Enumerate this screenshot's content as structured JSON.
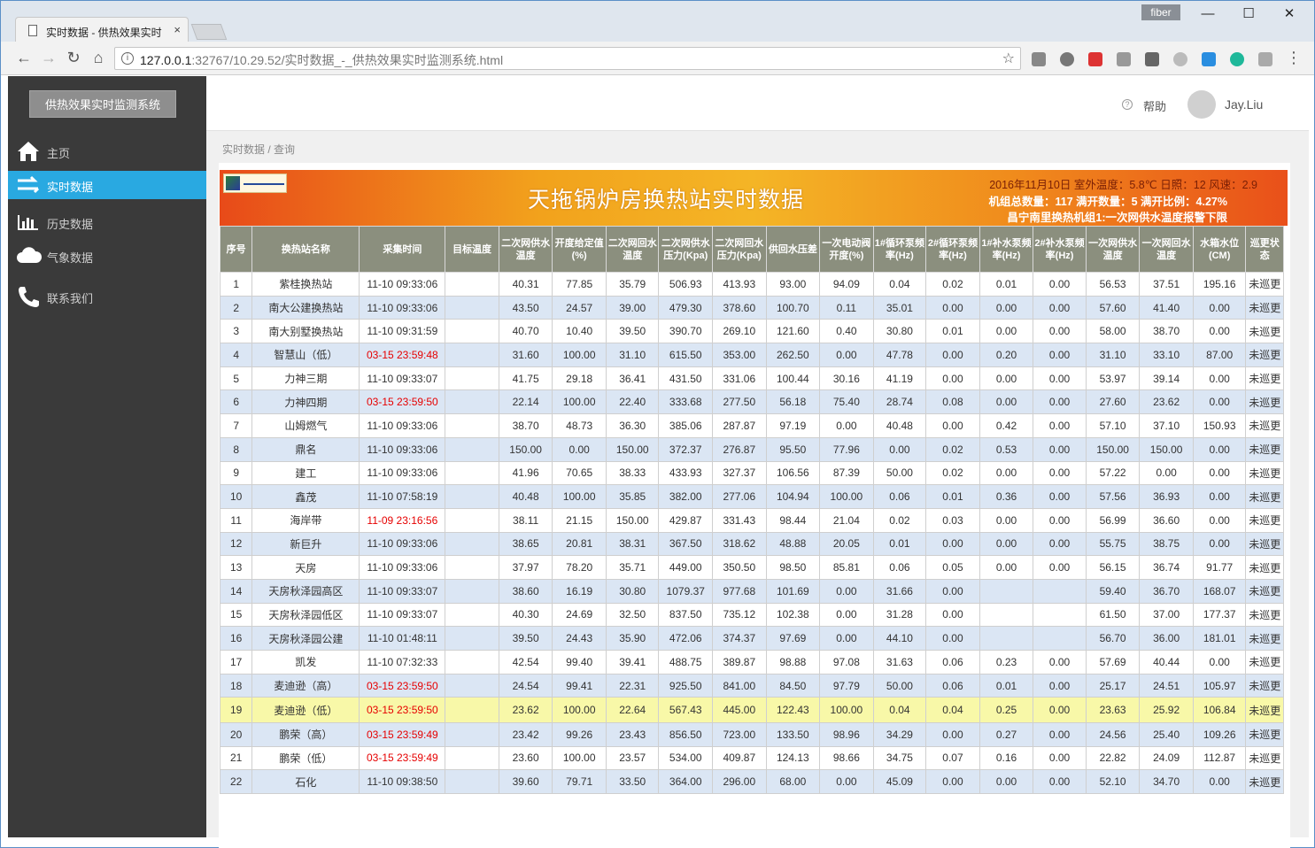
{
  "browser": {
    "tab_title": "实时数据 - 供热效果实时",
    "tab_close": "×",
    "profile": "fiber",
    "url_host": "127.0.0.1",
    "url_rest": ":32767/10.29.52/实时数据_-_供热效果实时监测系统.html",
    "minimize": "—",
    "maximize": "☐",
    "close": "✕",
    "back": "←",
    "forward": "→",
    "reload": "↻",
    "home": "⌂",
    "star": "☆",
    "menu": "⋮"
  },
  "sidebar": {
    "brand": "供热效果实时监测系统",
    "items": [
      {
        "label": "主页",
        "icon": "home-icon"
      },
      {
        "label": "实时数据",
        "icon": "exchange-icon"
      },
      {
        "label": "历史数据",
        "icon": "bar-chart-icon"
      },
      {
        "label": "气象数据",
        "icon": "cloud-icon"
      },
      {
        "label": "联系我们",
        "icon": "phone-icon"
      }
    ]
  },
  "header": {
    "help_icon": "?",
    "help": "帮助",
    "user": "Jay.Liu"
  },
  "breadcrumb": "实时数据 / 查询",
  "banner": {
    "title": "天拖锅炉房换热站实时数据",
    "line1": "2016年11月10日 室外温度：5.8℃ 日照：12 风速：2.9",
    "line2": "机组总数量：117 满开数量：5 满开比例：4.27%",
    "line3": "昌宁南里换热机组1:一次网供水温度报警下限"
  },
  "table": {
    "headers": [
      "序号",
      "换热站名称",
      "采集时间",
      "目标温度",
      "二次网供水温度",
      "开度给定值(%)",
      "二次网回水温度",
      "二次网供水压力(Kpa)",
      "二次网回水压力(Kpa)",
      "供回水压差",
      "一次电动阀开度(%)",
      "1#循环泵频率(Hz)",
      "2#循环泵频率(Hz)",
      "1#补水泵频率(Hz)",
      "2#补水泵频率(Hz)",
      "一次网供水温度",
      "一次网回水温度",
      "水箱水位(CM)",
      "巡更状态"
    ],
    "rows": [
      [
        "1",
        "紫桂换热站",
        "11-10 09:33:06",
        "",
        "40.31",
        "77.85",
        "35.79",
        "506.93",
        "413.93",
        "93.00",
        "94.09",
        "0.04",
        "0.02",
        "0.01",
        "0.00",
        "56.53",
        "37.51",
        "195.16",
        "未巡更"
      ],
      [
        "2",
        "南大公建换热站",
        "11-10 09:33:06",
        "",
        "43.50",
        "24.57",
        "39.00",
        "479.30",
        "378.60",
        "100.70",
        "0.11",
        "35.01",
        "0.00",
        "0.00",
        "0.00",
        "57.60",
        "41.40",
        "0.00",
        "未巡更"
      ],
      [
        "3",
        "南大别墅换热站",
        "11-10 09:31:59",
        "",
        "40.70",
        "10.40",
        "39.50",
        "390.70",
        "269.10",
        "121.60",
        "0.40",
        "30.80",
        "0.01",
        "0.00",
        "0.00",
        "58.00",
        "38.70",
        "0.00",
        "未巡更"
      ],
      [
        "4",
        "智慧山（低）",
        "03-15 23:59:48",
        "",
        "31.60",
        "100.00",
        "31.10",
        "615.50",
        "353.00",
        "262.50",
        "0.00",
        "47.78",
        "0.00",
        "0.20",
        "0.00",
        "31.10",
        "33.10",
        "87.00",
        "未巡更"
      ],
      [
        "5",
        "力神三期",
        "11-10 09:33:07",
        "",
        "41.75",
        "29.18",
        "36.41",
        "431.50",
        "331.06",
        "100.44",
        "30.16",
        "41.19",
        "0.00",
        "0.00",
        "0.00",
        "53.97",
        "39.14",
        "0.00",
        "未巡更"
      ],
      [
        "6",
        "力神四期",
        "03-15 23:59:50",
        "",
        "22.14",
        "100.00",
        "22.40",
        "333.68",
        "277.50",
        "56.18",
        "75.40",
        "28.74",
        "0.08",
        "0.00",
        "0.00",
        "27.60",
        "23.62",
        "0.00",
        "未巡更"
      ],
      [
        "7",
        "山姆燃气",
        "11-10 09:33:06",
        "",
        "38.70",
        "48.73",
        "36.30",
        "385.06",
        "287.87",
        "97.19",
        "0.00",
        "40.48",
        "0.00",
        "0.42",
        "0.00",
        "57.10",
        "37.10",
        "150.93",
        "未巡更"
      ],
      [
        "8",
        "鼎名",
        "11-10 09:33:06",
        "",
        "150.00",
        "0.00",
        "150.00",
        "372.37",
        "276.87",
        "95.50",
        "77.96",
        "0.00",
        "0.02",
        "0.53",
        "0.00",
        "150.00",
        "150.00",
        "0.00",
        "未巡更"
      ],
      [
        "9",
        "建工",
        "11-10 09:33:06",
        "",
        "41.96",
        "70.65",
        "38.33",
        "433.93",
        "327.37",
        "106.56",
        "87.39",
        "50.00",
        "0.02",
        "0.00",
        "0.00",
        "57.22",
        "0.00",
        "0.00",
        "未巡更"
      ],
      [
        "10",
        "鑫茂",
        "11-10 07:58:19",
        "",
        "40.48",
        "100.00",
        "35.85",
        "382.00",
        "277.06",
        "104.94",
        "100.00",
        "0.06",
        "0.01",
        "0.36",
        "0.00",
        "57.56",
        "36.93",
        "0.00",
        "未巡更"
      ],
      [
        "11",
        "海岸带",
        "11-09 23:16:56",
        "",
        "38.11",
        "21.15",
        "150.00",
        "429.87",
        "331.43",
        "98.44",
        "21.04",
        "0.02",
        "0.03",
        "0.00",
        "0.00",
        "56.99",
        "36.60",
        "0.00",
        "未巡更"
      ],
      [
        "12",
        "新巨升",
        "11-10 09:33:06",
        "",
        "38.65",
        "20.81",
        "38.31",
        "367.50",
        "318.62",
        "48.88",
        "20.05",
        "0.01",
        "0.00",
        "0.00",
        "0.00",
        "55.75",
        "38.75",
        "0.00",
        "未巡更"
      ],
      [
        "13",
        "天房",
        "11-10 09:33:06",
        "",
        "37.97",
        "78.20",
        "35.71",
        "449.00",
        "350.50",
        "98.50",
        "85.81",
        "0.06",
        "0.05",
        "0.00",
        "0.00",
        "56.15",
        "36.74",
        "91.77",
        "未巡更"
      ],
      [
        "14",
        "天房秋泽园高区",
        "11-10 09:33:07",
        "",
        "38.60",
        "16.19",
        "30.80",
        "1079.37",
        "977.68",
        "101.69",
        "0.00",
        "31.66",
        "0.00",
        "",
        "",
        "59.40",
        "36.70",
        "168.07",
        "未巡更"
      ],
      [
        "15",
        "天房秋泽园低区",
        "11-10 09:33:07",
        "",
        "40.30",
        "24.69",
        "32.50",
        "837.50",
        "735.12",
        "102.38",
        "0.00",
        "31.28",
        "0.00",
        "",
        "",
        "61.50",
        "37.00",
        "177.37",
        "未巡更"
      ],
      [
        "16",
        "天房秋泽园公建",
        "11-10 01:48:11",
        "",
        "39.50",
        "24.43",
        "35.90",
        "472.06",
        "374.37",
        "97.69",
        "0.00",
        "44.10",
        "0.00",
        "",
        "",
        "56.70",
        "36.00",
        "181.01",
        "未巡更"
      ],
      [
        "17",
        "凯发",
        "11-10 07:32:33",
        "",
        "42.54",
        "99.40",
        "39.41",
        "488.75",
        "389.87",
        "98.88",
        "97.08",
        "31.63",
        "0.06",
        "0.23",
        "0.00",
        "57.69",
        "40.44",
        "0.00",
        "未巡更"
      ],
      [
        "18",
        "麦迪逊（高）",
        "03-15 23:59:50",
        "",
        "24.54",
        "99.41",
        "22.31",
        "925.50",
        "841.00",
        "84.50",
        "97.79",
        "50.00",
        "0.06",
        "0.01",
        "0.00",
        "25.17",
        "24.51",
        "105.97",
        "未巡更"
      ],
      [
        "19",
        "麦迪逊（低）",
        "03-15 23:59:50",
        "",
        "23.62",
        "100.00",
        "22.64",
        "567.43",
        "445.00",
        "122.43",
        "100.00",
        "0.04",
        "0.04",
        "0.25",
        "0.00",
        "23.63",
        "25.92",
        "106.84",
        "未巡更"
      ],
      [
        "20",
        "鹏荣（高）",
        "03-15 23:59:49",
        "",
        "23.42",
        "99.26",
        "23.43",
        "856.50",
        "723.00",
        "133.50",
        "98.96",
        "34.29",
        "0.00",
        "0.27",
        "0.00",
        "24.56",
        "25.40",
        "109.26",
        "未巡更"
      ],
      [
        "21",
        "鹏荣（低）",
        "03-15 23:59:49",
        "",
        "23.60",
        "100.00",
        "23.57",
        "534.00",
        "409.87",
        "124.13",
        "98.66",
        "34.75",
        "0.07",
        "0.16",
        "0.00",
        "22.82",
        "24.09",
        "112.87",
        "未巡更"
      ],
      [
        "22",
        "石化",
        "11-10 09:38:50",
        "",
        "39.60",
        "79.71",
        "33.50",
        "364.00",
        "296.00",
        "68.00",
        "0.00",
        "45.09",
        "0.00",
        "0.00",
        "0.00",
        "52.10",
        "34.70",
        "0.00",
        "未巡更"
      ]
    ],
    "stale_rows": [
      4,
      6,
      11,
      18,
      19,
      20,
      21
    ],
    "highlight_row": 19
  },
  "colors": {
    "sidebar_bg": "#3a3a3a",
    "active_item": "#29a9e1",
    "header_bg": "#8b8f7e",
    "row_alt": "#dbe6f4",
    "highlight": "#f8f8a8",
    "stale_time": "#e60000"
  }
}
